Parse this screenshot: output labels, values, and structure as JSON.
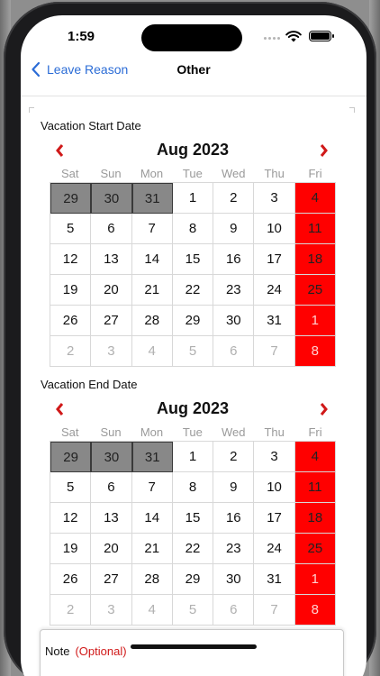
{
  "status_bar": {
    "time": "1:59"
  },
  "nav": {
    "back_label": "Leave Reason",
    "title": "Other"
  },
  "colors": {
    "accent": "#2b6cd6",
    "weekend": "#ff0000",
    "previous_month": "#888888",
    "arrow": "#d01919"
  },
  "calendar": {
    "weekdays": [
      "Sat",
      "Sun",
      "Mon",
      "Tue",
      "Wed",
      "Thu",
      "Fri"
    ],
    "prev_icon": "chevron-left-icon",
    "next_icon": "chevron-right-icon",
    "weeks": [
      [
        "29",
        "30",
        "31",
        "1",
        "2",
        "3",
        "4"
      ],
      [
        "5",
        "6",
        "7",
        "8",
        "9",
        "10",
        "11"
      ],
      [
        "12",
        "13",
        "14",
        "15",
        "16",
        "17",
        "18"
      ],
      [
        "19",
        "20",
        "21",
        "22",
        "23",
        "24",
        "25"
      ],
      [
        "26",
        "27",
        "28",
        "29",
        "30",
        "31",
        "1"
      ],
      [
        "2",
        "3",
        "4",
        "5",
        "6",
        "7",
        "8"
      ]
    ]
  },
  "start_calendar": {
    "label": "Vacation Start Date",
    "month_title": "Aug 2023"
  },
  "end_calendar": {
    "label": "Vacation End Date",
    "month_title": "Aug 2023"
  },
  "note": {
    "label": "Note",
    "optional": "(Optional)"
  }
}
